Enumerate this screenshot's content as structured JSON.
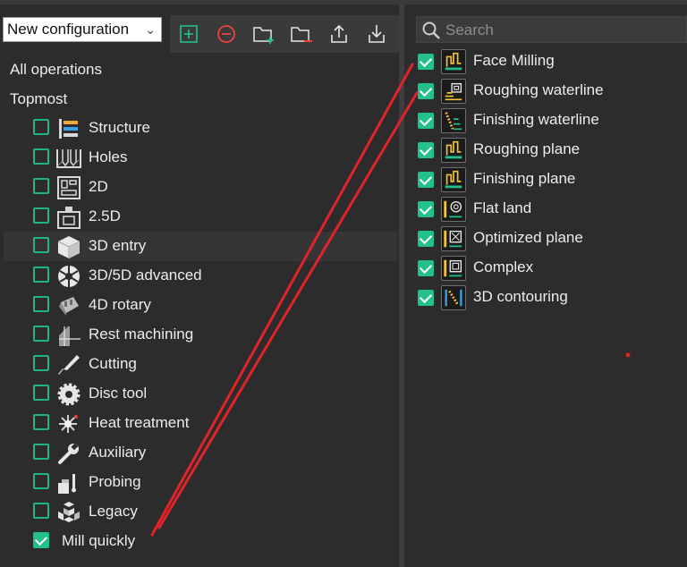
{
  "config": {
    "selected": "New configuration"
  },
  "toolbar": {
    "buttons": [
      "add-icon",
      "remove-icon",
      "add-folder-icon",
      "remove-folder-icon",
      "export-icon",
      "import-icon"
    ]
  },
  "tree": {
    "root_all": "All operations",
    "root_topmost": "Topmost",
    "items": [
      {
        "label": "Structure",
        "checked": false
      },
      {
        "label": "Holes",
        "checked": false
      },
      {
        "label": "2D",
        "checked": false
      },
      {
        "label": "2.5D",
        "checked": false
      },
      {
        "label": "3D entry",
        "checked": false,
        "selected": true
      },
      {
        "label": "3D/5D advanced",
        "checked": false
      },
      {
        "label": "4D rotary",
        "checked": false
      },
      {
        "label": "Rest machining",
        "checked": false
      },
      {
        "label": "Cutting",
        "checked": false
      },
      {
        "label": "Disc tool",
        "checked": false
      },
      {
        "label": "Heat treatment",
        "checked": false
      },
      {
        "label": "Auxiliary",
        "checked": false
      },
      {
        "label": "Probing",
        "checked": false
      },
      {
        "label": "Legacy",
        "checked": false
      },
      {
        "label": "Mill quickly",
        "checked": true
      }
    ]
  },
  "search": {
    "placeholder": "Search"
  },
  "operations": [
    {
      "label": "Face Milling",
      "checked": true
    },
    {
      "label": "Roughing waterline",
      "checked": true
    },
    {
      "label": "Finishing waterline",
      "checked": true
    },
    {
      "label": "Roughing plane",
      "checked": true
    },
    {
      "label": "Finishing plane",
      "checked": true
    },
    {
      "label": "Flat land",
      "checked": true
    },
    {
      "label": "Optimized plane",
      "checked": true
    },
    {
      "label": "Complex",
      "checked": true
    },
    {
      "label": "3D contouring",
      "checked": true
    }
  ],
  "colors": {
    "accent": "#22c08a",
    "annotation": "#e0242a",
    "background": "#2c2c2c"
  }
}
